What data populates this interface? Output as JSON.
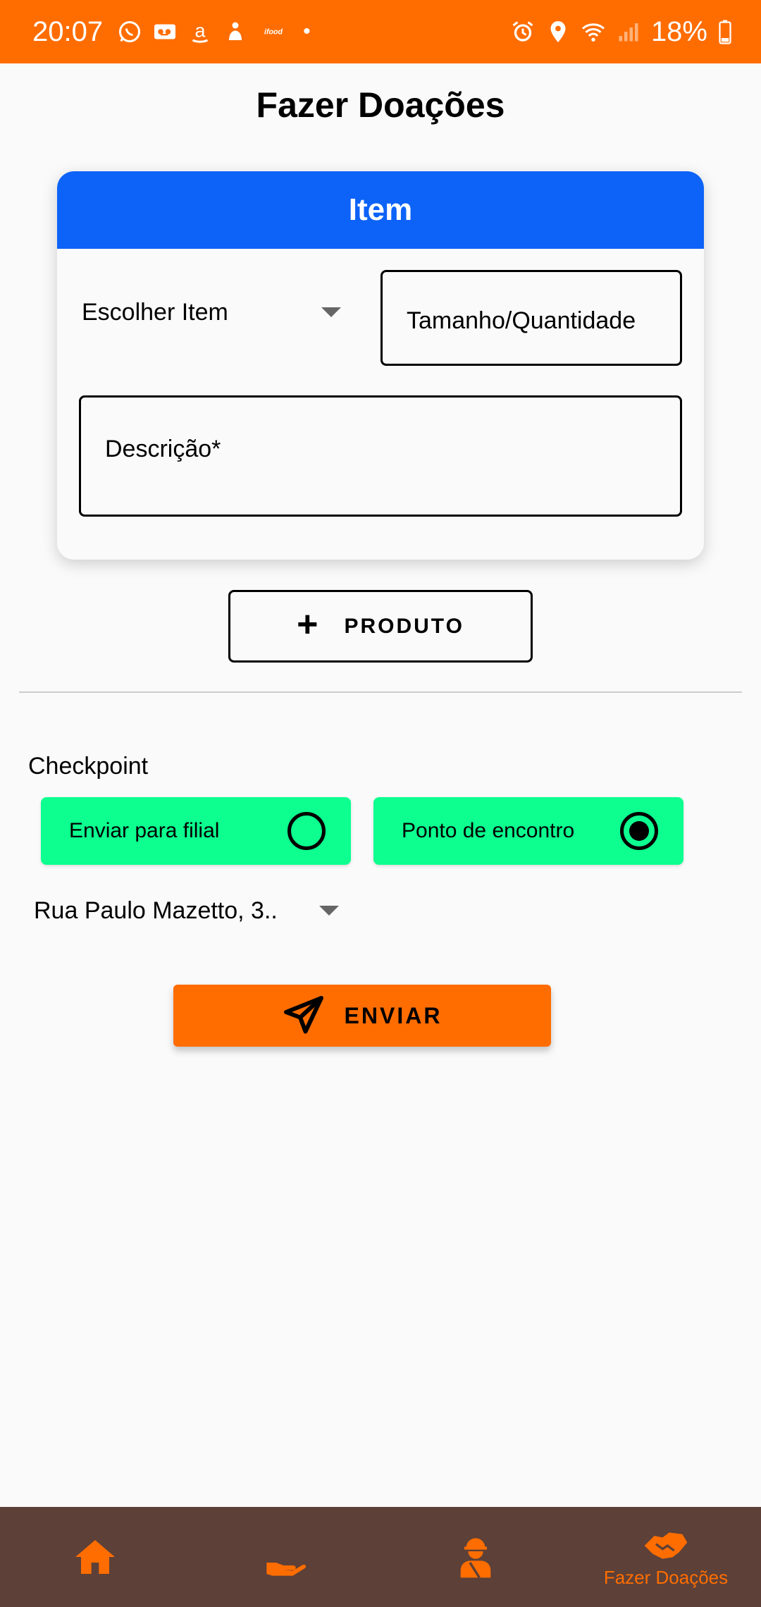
{
  "status_bar": {
    "time": "20:07",
    "icons_left": [
      "whatsapp-icon",
      "voicemail-icon",
      "amazon-icon",
      "app-icon",
      "ifood-icon"
    ],
    "ifood_text": "ifood",
    "dot": "•",
    "icons_right": [
      "alarm-icon",
      "location-icon",
      "wifi-icon",
      "signal-icon",
      "battery-icon"
    ],
    "battery": "18%"
  },
  "page": {
    "title": "Fazer Doações"
  },
  "item_card": {
    "header": "Item",
    "select_item_label": "Escolher Item",
    "qty_placeholder": "Tamanho/Quantidade",
    "description_placeholder": "Descrição*"
  },
  "add_product_button": {
    "icon": "+",
    "label": "PRODUTO"
  },
  "checkpoint": {
    "label": "Checkpoint",
    "options": [
      {
        "label": "Enviar para filial",
        "selected": false
      },
      {
        "label": "Ponto de encontro",
        "selected": true
      }
    ],
    "address": "Rua Paulo Mazetto, 3.."
  },
  "send_button": {
    "label": "ENVIAR"
  },
  "bottom_nav": {
    "items": [
      {
        "icon": "home-icon",
        "label": ""
      },
      {
        "icon": "hand-icon",
        "label": ""
      },
      {
        "icon": "volunteer-icon",
        "label": ""
      },
      {
        "icon": "handshake-icon",
        "label": "Fazer Doações"
      }
    ],
    "active_index": 3
  },
  "colors": {
    "accent": "#ff6d00",
    "card_header": "#0d63f8",
    "radio_card": "#0cff8f",
    "bottom_nav": "#5d4037"
  }
}
